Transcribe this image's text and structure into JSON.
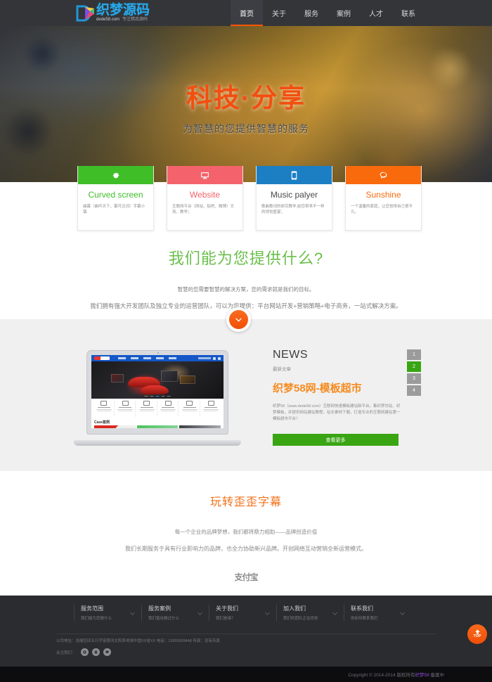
{
  "header": {
    "logo": {
      "main": "织梦源码",
      "sub_domain": "dede58.com",
      "sub_slogan": "专注精品源码",
      "icon": "logo-icon"
    },
    "nav": [
      {
        "label": "首页",
        "active": true
      },
      {
        "label": "关于",
        "active": false
      },
      {
        "label": "服务",
        "active": false
      },
      {
        "label": "案例",
        "active": false
      },
      {
        "label": "人才",
        "active": false
      },
      {
        "label": "联系",
        "active": false
      }
    ]
  },
  "hero": {
    "title": "科技·分享",
    "subtitle": "为智慧的您提供智慧的服务",
    "title_color": "#f24f10"
  },
  "cards": [
    {
      "title": "Curved screen",
      "desc": "曲幕（曲吟天下，幕可泛词）字幕小镇",
      "color": "#3fbe28",
      "icon": "gear-icon"
    },
    {
      "title": "Website",
      "desc": "互联网平台（网站、贴吧、微博）文苑、教学；",
      "color": "#f4636b",
      "icon": "monitor-icon"
    },
    {
      "title": "Music palyer",
      "desc": "歌曲歌词的研究教学,给您带来不一样的视觉盛宴；",
      "color": "#1c7fc4",
      "icon": "phone-icon"
    },
    {
      "title": "Sunshine",
      "desc": "一个温馨的家庭，让您觉得自己很不凡。",
      "color": "#f96a0d",
      "icon": "chat-icon"
    }
  ],
  "services": {
    "title": "我们能为您提供什么?",
    "p1": "智慧的您需要智慧的解决方案，您的需求就是我们的目标。",
    "p2": "我们拥有强大开发团队及独立专业的运营团队，可以为您提供：平台网站开发+营销策略+电子商务，一站式解决方案。",
    "scroll_icon": "chevron-down-icon"
  },
  "news": {
    "title": "NEWS",
    "subtitle": "最新文章",
    "headline": "织梦58网-模板超市",
    "body": "织梦58（www.dede58.com）互联网快速模板建站新平台，集织梦仿站、织梦模板，并提供网站建站教程，站长素材下载，打造专业的互联网建站第一模板超市平台！",
    "button": "查看更多",
    "pagination": [
      {
        "label": "1",
        "active": false
      },
      {
        "label": "2",
        "active": true
      },
      {
        "label": "3",
        "active": false
      },
      {
        "label": "4",
        "active": false
      }
    ],
    "laptop_case_label": "Case案例"
  },
  "brand": {
    "title": "玩转歪歪字幕",
    "p1": "每一个企业的品牌梦想，我们都将鼎力相助——品牌创造价值",
    "p2": "我们长期服务于具有行业影响力的品牌，也全力协助新兴品牌。开创网络互动营销全新运营模式。",
    "logo_text": "支付宝"
  },
  "footer": {
    "columns": [
      {
        "title": "服务范围",
        "subtitle": "我们能为您做什么",
        "icon": "chevron-down-icon"
      },
      {
        "title": "服务案例",
        "subtitle": "我们曾经做过什么",
        "icon": "chevron-down-icon"
      },
      {
        "title": "关于我们",
        "subtitle": "我们是谁？",
        "icon": "chevron-down-icon"
      },
      {
        "title": "加入我们",
        "subtitle": "我们的团队正在找你",
        "icon": "chevron-down-icon"
      },
      {
        "title": "联系我们",
        "subtitle": "你如何联系我们",
        "icon": "chevron-down-icon"
      }
    ],
    "address": "公司地址：浩瀚空间五行宇宙银河太阳系地球中国XX省XX 电话：13655699448 传真：没有传真",
    "follow_label": "关注我们：",
    "socials": [
      {
        "name": "weibo-icon"
      },
      {
        "name": "qq-icon"
      },
      {
        "name": "wechat-icon"
      }
    ],
    "copyright_prefix": "Copyright © 2014-2014 版权所有",
    "copyright_link": "织梦58",
    "copyright_suffix": "备案中",
    "top_button": {
      "label": "TOP",
      "icon": "arrow-up-icon"
    }
  }
}
